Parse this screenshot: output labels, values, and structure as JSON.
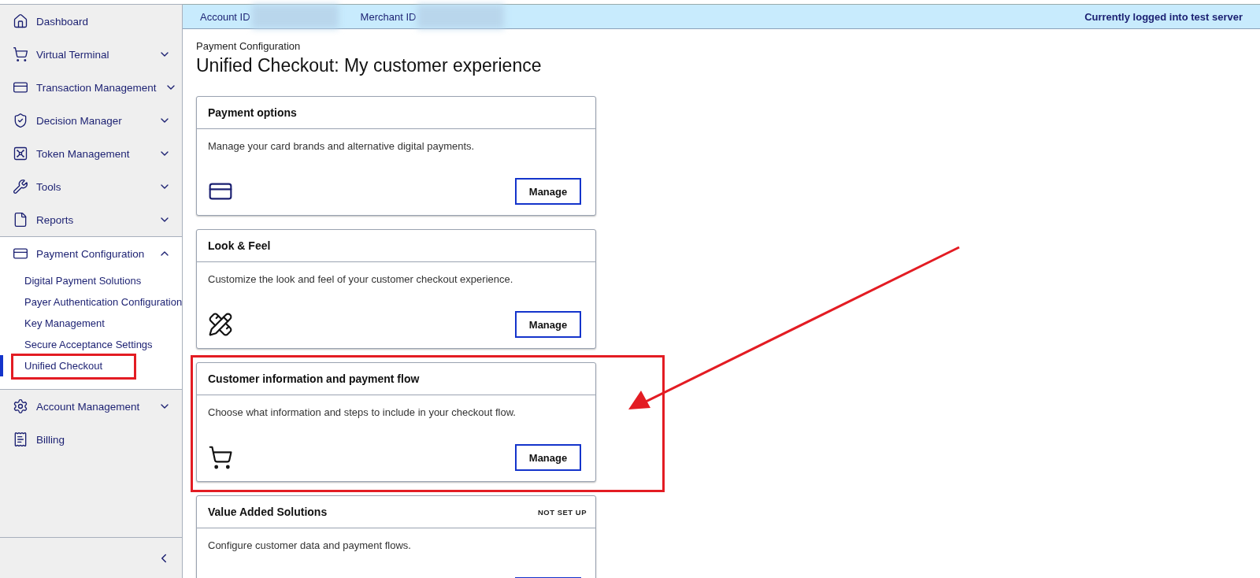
{
  "sidebar": {
    "items": [
      {
        "label": "Dashboard",
        "kind": "link"
      },
      {
        "label": "Virtual Terminal",
        "kind": "group",
        "expanded": false
      },
      {
        "label": "Transaction Management",
        "kind": "group",
        "expanded": false
      },
      {
        "label": "Decision Manager",
        "kind": "group",
        "expanded": false
      },
      {
        "label": "Token Management",
        "kind": "group",
        "expanded": false
      },
      {
        "label": "Tools",
        "kind": "group",
        "expanded": false
      },
      {
        "label": "Reports",
        "kind": "group",
        "expanded": false
      },
      {
        "label": "Payment Configuration",
        "kind": "group",
        "expanded": true,
        "children": [
          {
            "label": "Digital Payment Solutions",
            "selected": false,
            "highlighted": false
          },
          {
            "label": "Payer Authentication Configuration",
            "selected": false,
            "highlighted": false
          },
          {
            "label": "Key Management",
            "selected": false,
            "highlighted": false
          },
          {
            "label": "Secure Acceptance Settings",
            "selected": false,
            "highlighted": false
          },
          {
            "label": "Unified Checkout",
            "selected": true,
            "highlighted": true
          }
        ]
      },
      {
        "label": "Account Management",
        "kind": "group",
        "expanded": false
      },
      {
        "label": "Billing",
        "kind": "link"
      }
    ]
  },
  "top_bar": {
    "account_label": "Account ID",
    "merchant_label": "Merchant ID",
    "server_status": "Currently logged into test server"
  },
  "breadcrumb": "Payment Configuration",
  "page_title": "Unified Checkout: My customer experience",
  "cards": [
    {
      "title": "Payment options",
      "description": "Manage your card brands and alternative digital payments.",
      "button": "Manage",
      "highlighted": false
    },
    {
      "title": "Look & Feel",
      "description": "Customize the look and feel of your customer checkout experience.",
      "button": "Manage",
      "highlighted": false
    },
    {
      "title": "Customer information and payment flow",
      "description": "Choose what information and steps to include in your checkout flow.",
      "button": "Manage",
      "highlighted": true
    },
    {
      "title": "Value Added Solutions",
      "status": "NOT SET UP",
      "description": "Configure customer data and payment flows.",
      "highlighted": false
    }
  ]
}
